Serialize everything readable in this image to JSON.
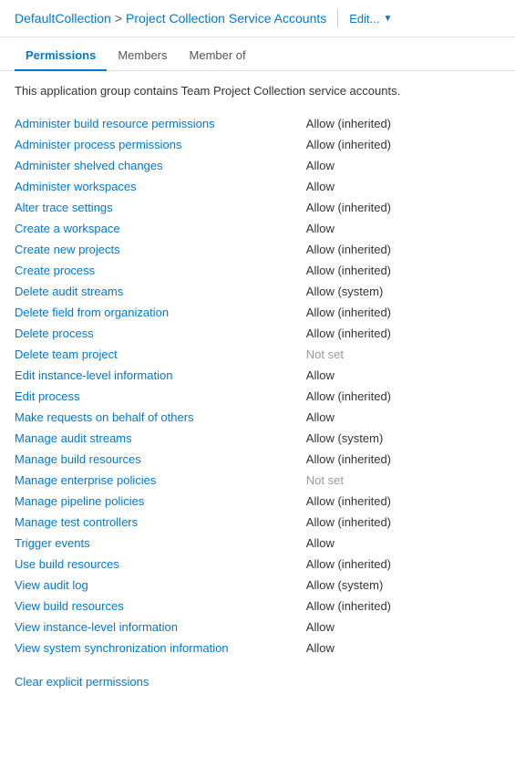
{
  "header": {
    "collection": "DefaultCollection",
    "separator": ">",
    "current": "Project Collection Service Accounts",
    "edit_label": "Edit...",
    "divider": "|"
  },
  "tabs": [
    {
      "id": "permissions",
      "label": "Permissions",
      "active": true
    },
    {
      "id": "members",
      "label": "Members",
      "active": false
    },
    {
      "id": "member-of",
      "label": "Member of",
      "active": false
    }
  ],
  "description": "This application group contains Team Project Collection service accounts.",
  "permissions": [
    {
      "name": "Administer build resource permissions",
      "value": "Allow (inherited)"
    },
    {
      "name": "Administer process permissions",
      "value": "Allow (inherited)"
    },
    {
      "name": "Administer shelved changes",
      "value": "Allow"
    },
    {
      "name": "Administer workspaces",
      "value": "Allow"
    },
    {
      "name": "Alter trace settings",
      "value": "Allow (inherited)"
    },
    {
      "name": "Create a workspace",
      "value": "Allow"
    },
    {
      "name": "Create new projects",
      "value": "Allow (inherited)"
    },
    {
      "name": "Create process",
      "value": "Allow (inherited)"
    },
    {
      "name": "Delete audit streams",
      "value": "Allow (system)"
    },
    {
      "name": "Delete field from organization",
      "value": "Allow (inherited)"
    },
    {
      "name": "Delete process",
      "value": "Allow (inherited)"
    },
    {
      "name": "Delete team project",
      "value": "Not set"
    },
    {
      "name": "Edit instance-level information",
      "value": "Allow"
    },
    {
      "name": "Edit process",
      "value": "Allow (inherited)"
    },
    {
      "name": "Make requests on behalf of others",
      "value": "Allow"
    },
    {
      "name": "Manage audit streams",
      "value": "Allow (system)"
    },
    {
      "name": "Manage build resources",
      "value": "Allow (inherited)"
    },
    {
      "name": "Manage enterprise policies",
      "value": "Not set"
    },
    {
      "name": "Manage pipeline policies",
      "value": "Allow (inherited)"
    },
    {
      "name": "Manage test controllers",
      "value": "Allow (inherited)"
    },
    {
      "name": "Trigger events",
      "value": "Allow"
    },
    {
      "name": "Use build resources",
      "value": "Allow (inherited)"
    },
    {
      "name": "View audit log",
      "value": "Allow (system)"
    },
    {
      "name": "View build resources",
      "value": "Allow (inherited)"
    },
    {
      "name": "View instance-level information",
      "value": "Allow"
    },
    {
      "name": "View system synchronization information",
      "value": "Allow"
    }
  ],
  "clear_label": "Clear explicit permissions"
}
